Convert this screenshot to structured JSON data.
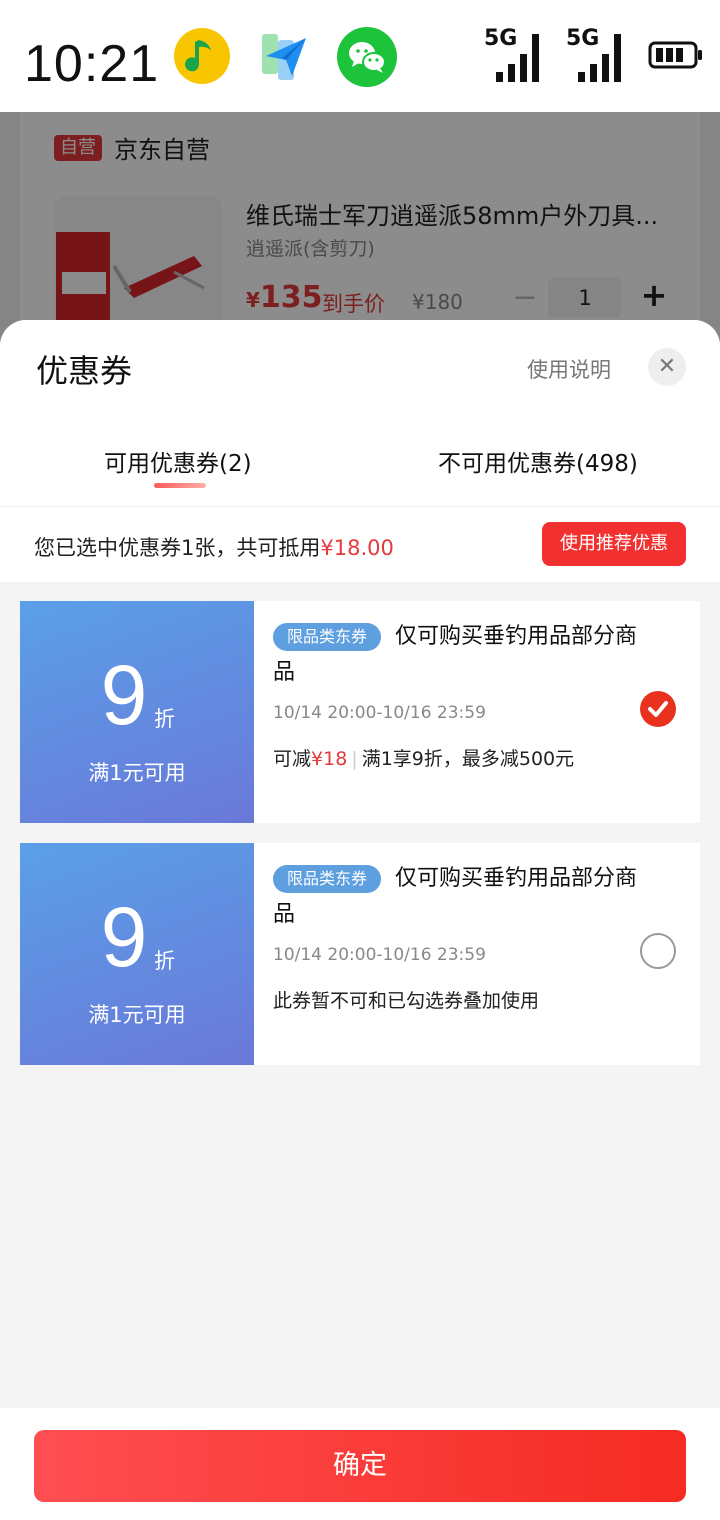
{
  "status_bar": {
    "time": "10:21",
    "apps": [
      "qq-music-icon",
      "navigation-app-icon",
      "wechat-icon"
    ],
    "network_1": "5G",
    "network_2": "5G"
  },
  "product": {
    "shop_badge": "自营",
    "shop_name": "京东自营",
    "title": "维氏瑞士军刀逍遥派58mm户外刀具...",
    "spec": "逍遥派(含剪刀)",
    "price_symbol": "¥",
    "price": "135",
    "price_tag": "到手价",
    "original_price": "¥180",
    "quantity": "1",
    "minus": "−",
    "plus": "+"
  },
  "sheet": {
    "title": "优惠券",
    "usage_link": "使用说明",
    "close": "✕",
    "tabs": [
      {
        "label": "可用优惠券(2)",
        "active": true
      },
      {
        "label": "不可用优惠券(498)",
        "active": false
      }
    ],
    "summary_prefix": "您已选中优惠券1张，共可抵用",
    "summary_amount": "¥18.00",
    "recommend_button": "使用推荐优惠"
  },
  "coupons": [
    {
      "discount": "9",
      "unit": "折",
      "threshold": "满1元可用",
      "category": "限品类东券",
      "title": "仅可购买垂钓用品部分商品",
      "date": "10/14 20:00-10/16 23:59",
      "note_prefix": "可减",
      "note_amount": "¥18",
      "note_separator": "|",
      "note_rest": "满1享9折，最多减500元",
      "selected": true
    },
    {
      "discount": "9",
      "unit": "折",
      "threshold": "满1元可用",
      "category": "限品类东券",
      "title": "仅可购买垂钓用品部分商品",
      "date": "10/14 20:00-10/16 23:59",
      "note": "此券暂不可和已勾选券叠加使用",
      "selected": false
    }
  ],
  "confirm_button": "确定",
  "colors": {
    "brand_red": "#e4393c",
    "coupon_blue": "#5e9fe0",
    "check_red": "#e8321e"
  }
}
